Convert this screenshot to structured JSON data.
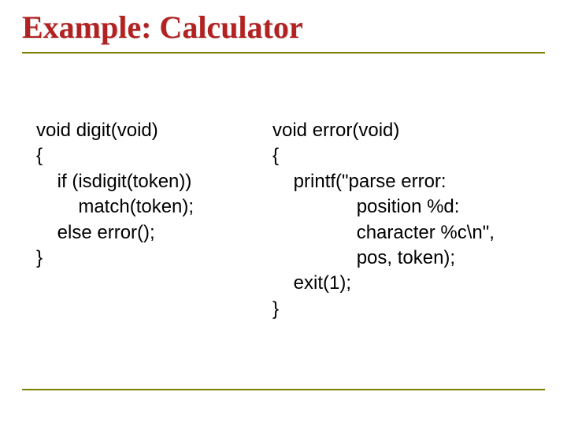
{
  "title": "Example: Calculator",
  "left_code": "void digit(void)\n{\n    if (isdigit(token))\n        match(token);\n    else error();\n}",
  "right_code": "void error(void)\n{\n    printf(\"parse error:\n                position %d:\n                character %c\\n\",\n                pos, token);\n    exit(1);\n}"
}
